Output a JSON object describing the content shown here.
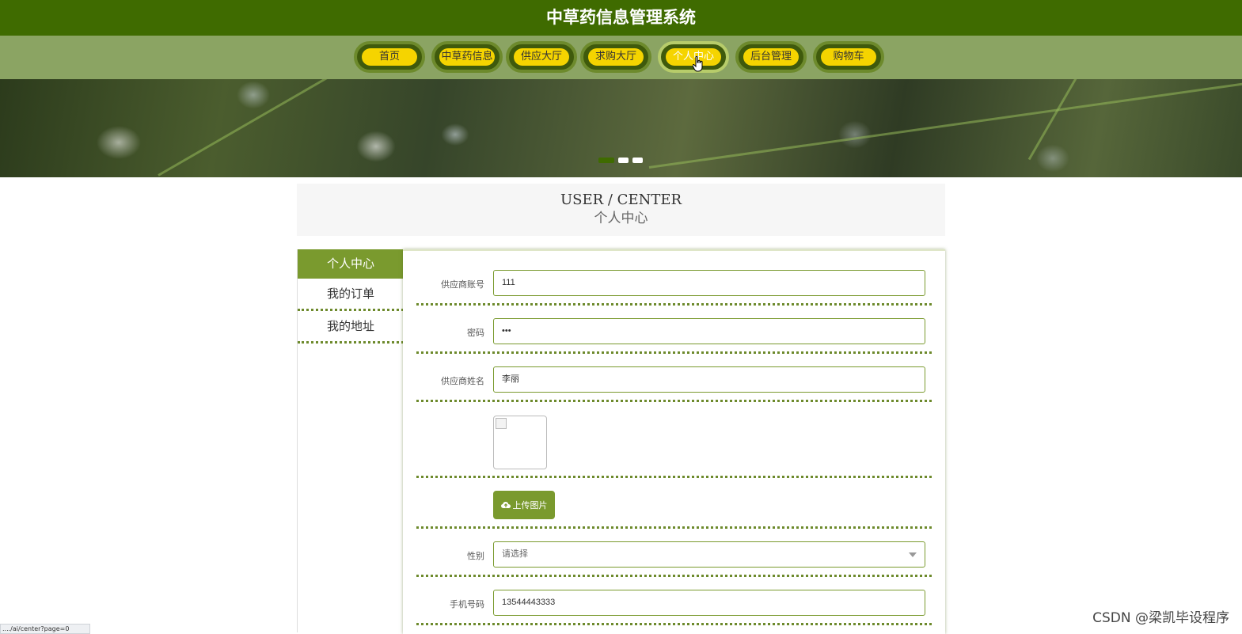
{
  "header": {
    "title": "中草药信息管理系统"
  },
  "nav": {
    "items": [
      {
        "label": "首页"
      },
      {
        "label": "中草药信息"
      },
      {
        "label": "供应大厅"
      },
      {
        "label": "求购大厅"
      },
      {
        "label": "个人中心"
      },
      {
        "label": "后台管理"
      },
      {
        "label": "购物车"
      }
    ],
    "active_index": 4
  },
  "carousel": {
    "slide_count": 3,
    "active_index": 0
  },
  "section": {
    "title_en": "USER / CENTER",
    "title_cn": "个人中心"
  },
  "sidebar": {
    "items": [
      {
        "label": "个人中心"
      },
      {
        "label": "我的订单"
      },
      {
        "label": "我的地址"
      }
    ],
    "active_index": 0
  },
  "form": {
    "account": {
      "label": "供应商账号",
      "value": "111"
    },
    "password": {
      "label": "密码",
      "value": "•••"
    },
    "name": {
      "label": "供应商姓名",
      "value": "李丽"
    },
    "upload_label": "上传图片",
    "gender": {
      "label": "性别",
      "placeholder": "请选择"
    },
    "phone": {
      "label": "手机号码",
      "value": "13544443333"
    }
  },
  "watermark": "CSDN @梁凯毕设程序",
  "status_url": "..../ai/center?page=0",
  "colors": {
    "header_bg": "#3f6b00",
    "nav_bg": "#8ba463",
    "accent": "#7a9a2e",
    "nav_pill": "#f5d400"
  }
}
